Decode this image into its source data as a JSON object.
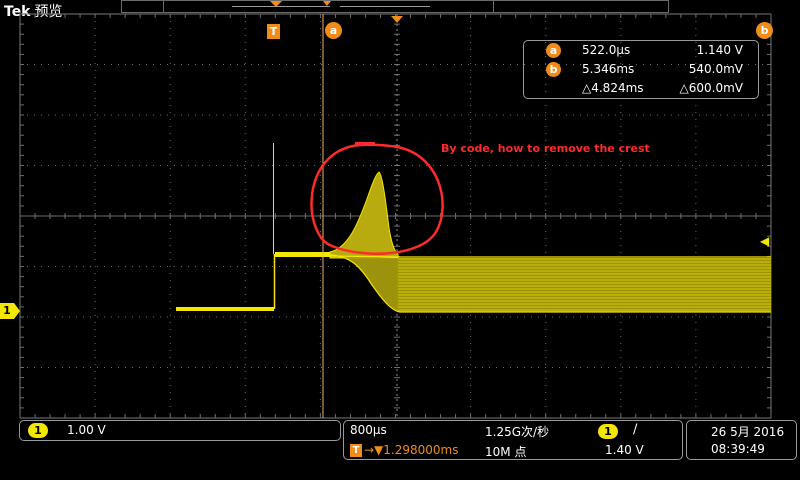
{
  "brand": {
    "logo": "Tek",
    "mode": "预览"
  },
  "markers": {
    "trigger": "T",
    "cursor_a": "a",
    "cursor_b": "b",
    "channel": "1",
    "trigger_level_icon": "left-arrow-icon"
  },
  "readout": {
    "a": {
      "label": "a",
      "time": "522.0µs",
      "value": "1.140 V"
    },
    "b": {
      "label": "b",
      "time": "5.346ms",
      "value": "540.0mV"
    },
    "delta": {
      "time": "△4.824ms",
      "value": "△600.0mV"
    }
  },
  "annotation": {
    "text": "By code, how to remove the crest"
  },
  "status": {
    "channel": {
      "badge": "1",
      "scale": "1.00 V"
    },
    "timebase": {
      "scale": "800µs",
      "sample_rate": "1.25G次/秒",
      "trigger_badge": "T",
      "position": "→▼1.298000ms",
      "record_length": "10M 点",
      "trigger_channel": "1",
      "slope": "∕",
      "trigger_level": "1.40 V"
    },
    "datetime": {
      "date": "26 5月 2016",
      "time": "08:39:49"
    }
  },
  "colors": {
    "trace": "#f3e600",
    "cursor": "#f08c17",
    "annotation": "#ff2a2a",
    "grid": "#7a7a7a",
    "background": "#000000"
  }
}
